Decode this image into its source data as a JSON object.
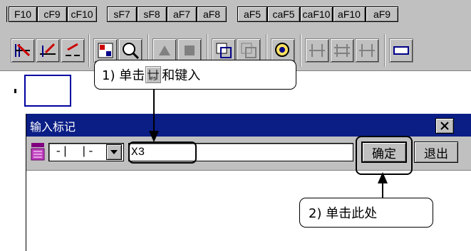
{
  "fkeys": [
    "F10",
    "cF9",
    "cF10",
    "sF7",
    "sF8",
    "aF7",
    "aF8",
    "aF5",
    "caF5",
    "caF10",
    "aF10",
    "aF9"
  ],
  "callout1": {
    "prefix": "1) 单击",
    "suffix": "和键入"
  },
  "callout2": {
    "text": "2) 单击此处"
  },
  "dialog": {
    "title": "输入标记",
    "close_icon": "close-icon",
    "symbols": [
      "-|",
      "|-"
    ],
    "input_value": "X3",
    "ok_label": "确定",
    "exit_label": "退出"
  },
  "colors": {
    "titlebar": "#0a1e86",
    "face": "#c0c0c0",
    "focus_box": "#0000a0"
  }
}
